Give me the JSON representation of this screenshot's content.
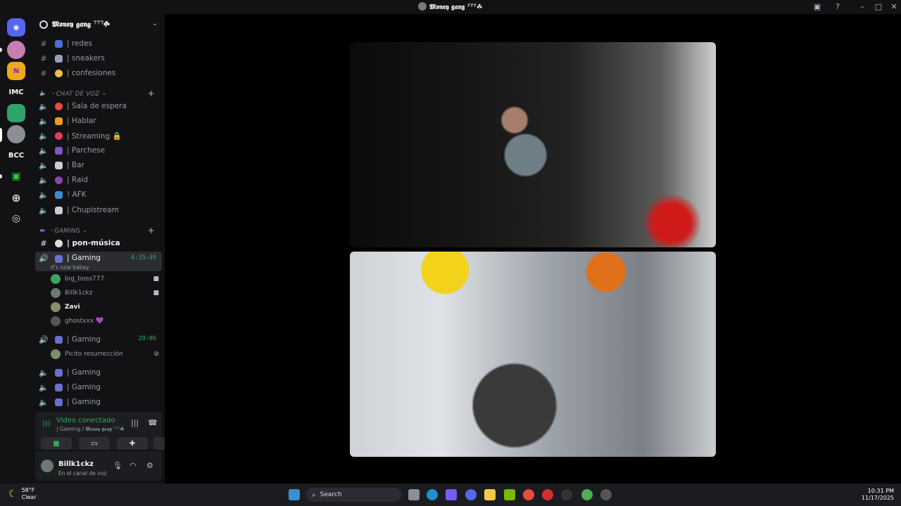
{
  "window": {
    "title": "𝕸𝖔𝖓𝖊𝖞 𝖌𝖆𝖓𝖌 ⁷⁷⁷☘",
    "controls": [
      "inbox-icon",
      "help-icon",
      "minimize",
      "maximize",
      "close"
    ]
  },
  "rail": {
    "servers": [
      {
        "label": "",
        "color": "#c77fb0"
      },
      {
        "label": "N",
        "color": "#f0a81c"
      },
      {
        "label": "IMC",
        "color": "#121214"
      },
      {
        "label": "",
        "color": "#2fa36b"
      },
      {
        "label": "",
        "color": "#8a8f96"
      },
      {
        "label": "BCC",
        "color": "#121214"
      },
      {
        "label": "",
        "color": "#2ecc40"
      }
    ]
  },
  "guild": {
    "name": "𝕸𝖔𝖓𝖊𝖞 𝖌𝖆𝖓𝖌 ⁷⁷⁷☘"
  },
  "channels": {
    "text_top": [
      {
        "name": "| redes"
      },
      {
        "name": "| sneakers"
      },
      {
        "name": "| confesiones"
      }
    ],
    "voice_category": "・CHAT DE VOZ",
    "voice": [
      {
        "name": "| Sala de espera"
      },
      {
        "name": "| Hablar"
      },
      {
        "name": "| Streaming 🔒"
      },
      {
        "name": "| Parchese"
      },
      {
        "name": "| Bar"
      },
      {
        "name": "| Raid"
      },
      {
        "name": "! AFK"
      },
      {
        "name": "| Chupistream"
      }
    ],
    "gaming_category": "・GAMING",
    "gaming_text": {
      "name": "| pon-música"
    },
    "active_voice": {
      "name": "| Gaming",
      "timer": "4:35:49",
      "status": "it's now babay"
    },
    "members": [
      {
        "name": "big_boss777.",
        "color": "#3ba55d"
      },
      {
        "name": "Billk1ckz",
        "color": "#6b7a6f"
      },
      {
        "name": "Zavi",
        "color": "#8d8d6e"
      },
      {
        "name": "ghostxxx 💜",
        "color": "#555"
      }
    ],
    "second_voice": {
      "name": "| Gaming",
      "timer": "20:06"
    },
    "second_member": {
      "name": "Picito resurrección",
      "color": "#7a8f6a"
    },
    "more_voice": [
      {
        "name": "| Gaming"
      },
      {
        "name": "| Gaming"
      },
      {
        "name": "| Gaming"
      }
    ]
  },
  "voice_panel": {
    "status": "Video conectado",
    "location": "| Gaming / 𝕸𝖔𝖓𝖊𝖞 𝖌𝖆𝖓𝖌 ⁷⁷⁷☘"
  },
  "user_panel": {
    "username": "Billk1ckz",
    "status": "En el canal de voz"
  },
  "taskbar": {
    "weather_temp": "58°F",
    "weather_desc": "Clear",
    "search_label": "Search",
    "time": "10:31 PM",
    "date": "11/17/2025"
  }
}
